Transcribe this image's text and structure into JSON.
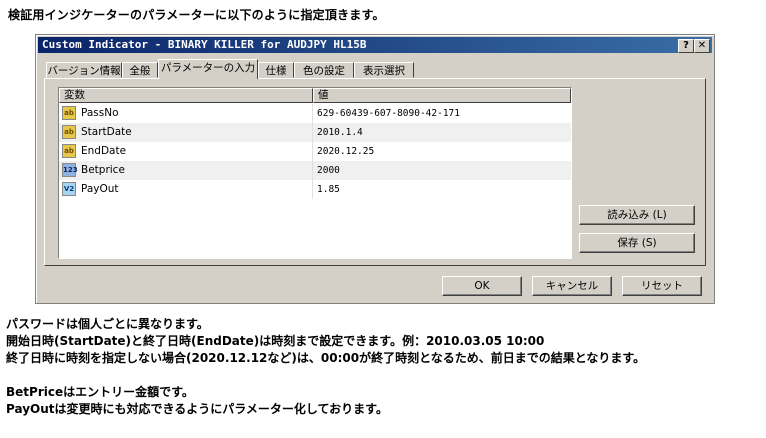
{
  "heading": "検証用インジケーターのパラメーターに以下のように指定頂きます。",
  "dialog": {
    "title": "Custom Indicator - BINARY KILLER for AUDJPY HL15B",
    "help_label": "?",
    "close_label": "✕",
    "tabs": [
      "バージョン情報",
      "全般",
      "パラメーターの入力",
      "仕様",
      "色の設定",
      "表示選択"
    ],
    "active_tab": "パラメーターの入力",
    "grid": {
      "headers": [
        "変数",
        "値"
      ],
      "rows": [
        {
          "icon": "ab",
          "name": "PassNo",
          "value": "629-60439-607-8090-42-171"
        },
        {
          "icon": "ab",
          "name": "StartDate",
          "value": "2010.1.4"
        },
        {
          "icon": "ab",
          "name": "EndDate",
          "value": "2020.12.25"
        },
        {
          "icon": "123",
          "name": "Betprice",
          "value": "2000"
        },
        {
          "icon": "V2",
          "name": "PayOut",
          "value": "1.85"
        }
      ]
    },
    "load_label": "読み込み (L)",
    "save_label": "保存 (S)",
    "ok_label": "OK",
    "cancel_label": "キャンセル",
    "reset_label": "リセット"
  },
  "notes": [
    "パスワードは個人ごとに異なります。",
    "開始日時(StartDate)と終了日時(EndDate)は時刻まで設定できます。例：2010.03.05 10:00",
    "終了日時に時刻を指定しない場合(2020.12.12など)は、00:00が終了時刻となるため、前日までの結果となります。",
    "",
    "BetPriceはエントリー金額です。",
    "PayOutは変更時にも対応できるようにパラメーター化しております。"
  ]
}
